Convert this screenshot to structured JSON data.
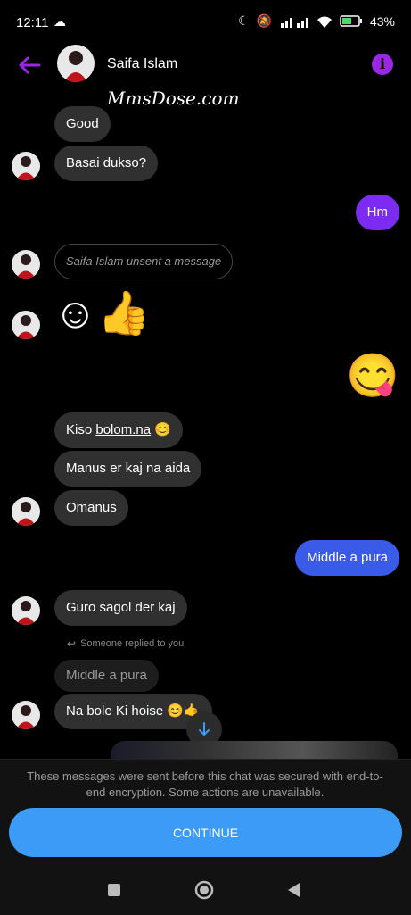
{
  "status": {
    "time": "12:11",
    "battery": "43%"
  },
  "header": {
    "contact_name": "Saifa Islam",
    "watermark": "MmsDose.com"
  },
  "icons": [
    "back-arrow-icon",
    "info-icon",
    "moon-icon",
    "mute-icon",
    "signal-icon",
    "wifi-icon",
    "battery-icon",
    "reply-icon",
    "down-arrow-icon",
    "square-icon",
    "circle-icon",
    "triangle-back-icon"
  ],
  "messages": {
    "m1": "Good",
    "m2": "Basai dukso?",
    "m3": "Hm",
    "m4": "Saifa Islam unsent a message",
    "m5_emojis": "☺👍",
    "m6_emoji": "😋",
    "m7_pre": "Kiso ",
    "m7_link": "bolom.na",
    "m7_emoji": "😊",
    "m8": "Manus er kaj na aida",
    "m9": "Omanus",
    "m10": "Middle a pura",
    "m11": "Guro sagol der kaj",
    "reply_label": "Someone replied to you",
    "quoted": "Middle a pura",
    "m12": "Na bole Ki hoise 😊🤙"
  },
  "footer": {
    "notice": "These messages were sent before this chat was secured with end-to-end encryption. Some actions are unavailable.",
    "continue_label": "CONTINUE"
  },
  "colors": {
    "sent_purple": "#7b2cf0",
    "sent_blue": "#3a5ae8",
    "received": "#303030",
    "accent": "#9b27e6",
    "button": "#3c9bf6"
  }
}
